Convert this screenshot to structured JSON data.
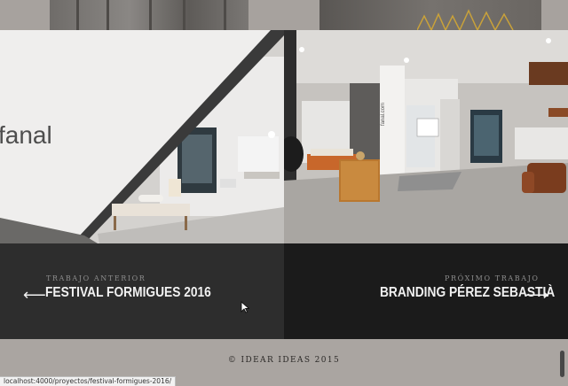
{
  "navigation": {
    "previous": {
      "kicker": "TRABAJO ANTERIOR",
      "arrow": "⟵",
      "title": "FESTIVAL FORMIGUES 2016",
      "image_brand_text": "fanal"
    },
    "next": {
      "kicker": "PRÓXIMO TRABAJO",
      "arrow": "⟶",
      "title": "BRANDING PÉREZ SEBASTIÀ",
      "image_brand_text": "fanal.com"
    }
  },
  "footer": {
    "copyright": "© IDEAR IDEAS 2015"
  },
  "browser": {
    "status_url": "localhost:4000/proyectos/festival-formigues-2016/"
  }
}
